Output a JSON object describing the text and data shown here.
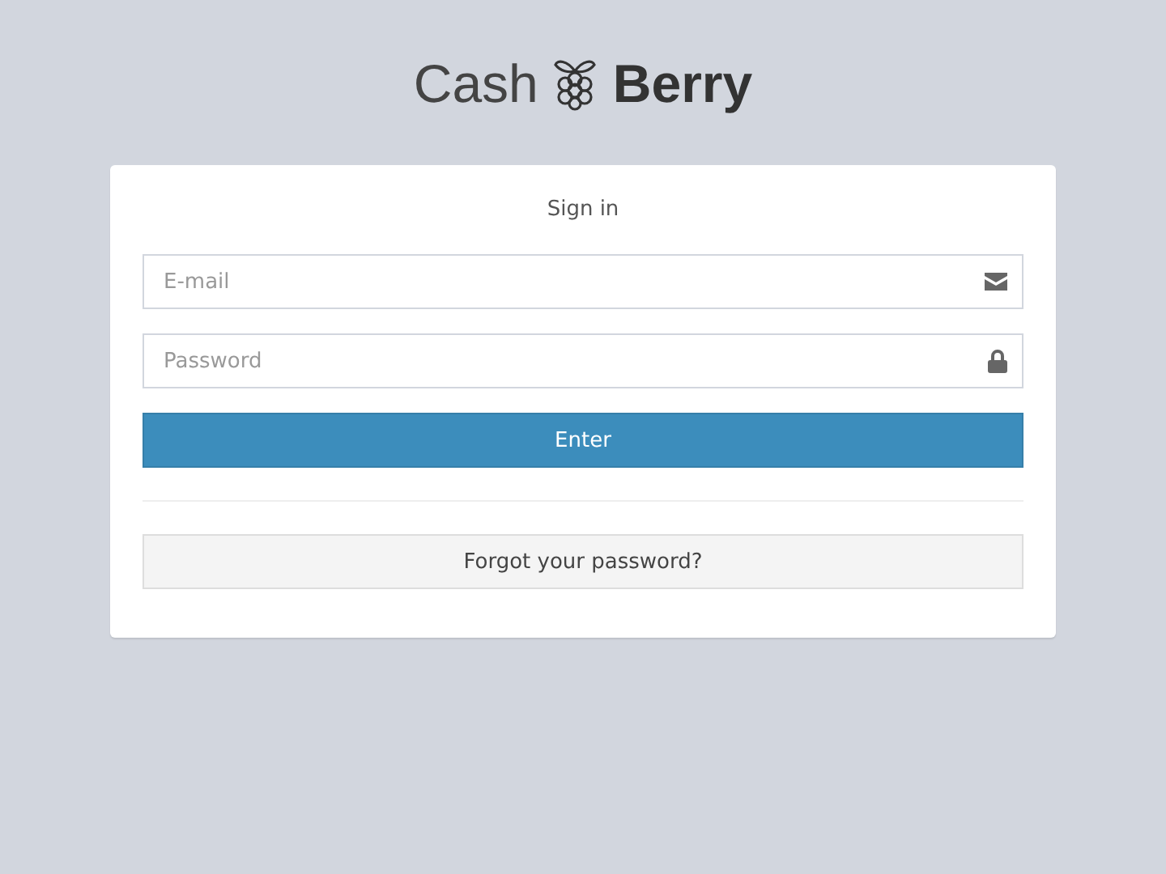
{
  "logo": {
    "light": "Cash",
    "bold": "Berry"
  },
  "card": {
    "title": "Sign in",
    "fields": [
      {
        "placeholder": "E-mail",
        "kind": "email"
      },
      {
        "placeholder": "Password",
        "kind": "password"
      }
    ],
    "submit": "Enter",
    "forgot": "Forgot your password?"
  }
}
